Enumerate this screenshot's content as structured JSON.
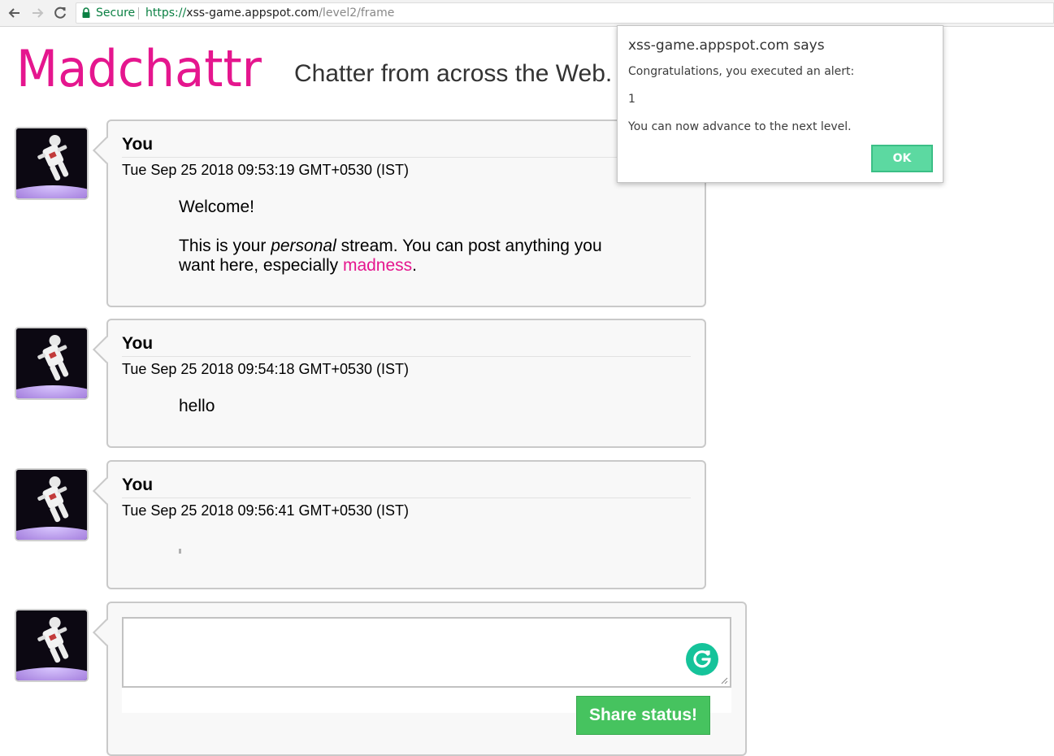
{
  "browser": {
    "secure_label": "Secure",
    "url_scheme": "https://",
    "url_host": "xss-game.appspot.com",
    "url_path": "/level2/frame"
  },
  "header": {
    "logo_text": "Madchattr",
    "tagline": "Chatter from across the Web."
  },
  "posts": [
    {
      "author": "You",
      "date": "Tue Sep 25 2018 09:53:19 GMT+0530 (IST)",
      "welcome": "Welcome!",
      "text_prefix": "This is your ",
      "text_em": "personal",
      "text_mid": " stream. You can post anything you want here, especially ",
      "text_link": "madness",
      "text_suffix": "."
    },
    {
      "author": "You",
      "date": "Tue Sep 25 2018 09:54:18 GMT+0530 (IST)",
      "text": "hello"
    },
    {
      "author": "You",
      "date": "Tue Sep 25 2018 09:56:41 GMT+0530 (IST)"
    }
  ],
  "composer": {
    "value": "",
    "button_label": "Share status!"
  },
  "alert": {
    "title": "xss-game.appspot.com says",
    "line1": "Congratulations, you executed an alert:",
    "line2": "1",
    "line3": "You can now advance to the next level.",
    "ok_label": "OK"
  },
  "colors": {
    "logo": "#e5168e",
    "madness_link": "#e5168e",
    "share_button": "#46c35f",
    "ok_button": "#5cd9a1",
    "secure": "#0b8043"
  }
}
